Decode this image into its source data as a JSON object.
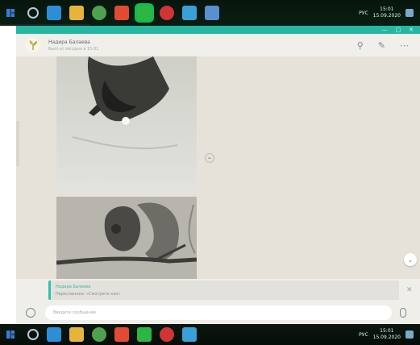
{
  "taskbar_top": {
    "icons": [
      "edge-browser-icon",
      "file-explorer-icon",
      "chrome-icon",
      "documents-icon",
      "whatsapp-icon",
      "opera-icon",
      "telegram-icon",
      "app-icon"
    ],
    "icon_colors": [
      "#2a8fd6",
      "#e6b43a",
      "#4ea24f",
      "#e24a33",
      "#2bb742",
      "#d03535",
      "#3aa0d8",
      "#5a8fd0"
    ],
    "tray": {
      "language": "РУС",
      "time": "15:01",
      "date": "15.09.2020"
    }
  },
  "taskbar_bottom": {
    "icons": [
      "edge-browser-icon",
      "file-explorer-icon",
      "chrome-icon",
      "documents-icon",
      "whatsapp-icon",
      "opera-icon",
      "telegram-icon"
    ],
    "tray": {
      "language": "РУС",
      "time": "15:01",
      "date": "15.09.2020"
    }
  },
  "window": {
    "title_controls": [
      "—",
      "□",
      "✕"
    ]
  },
  "chat_header": {
    "contact_name": "Надира Балаева",
    "status": "был(-а) сегодня в 15:01",
    "icons": [
      "search-icon",
      "attach-icon",
      "menu-icon"
    ]
  },
  "reply": {
    "name": "Надира Балаева",
    "text": "Пересланное: «Смотрите как»"
  },
  "compose": {
    "placeholder": "Введите сообщение"
  },
  "colors": {
    "accent": "#25b7a2",
    "chat_bg": "#e6e2da",
    "header_bg": "#f0efea"
  }
}
